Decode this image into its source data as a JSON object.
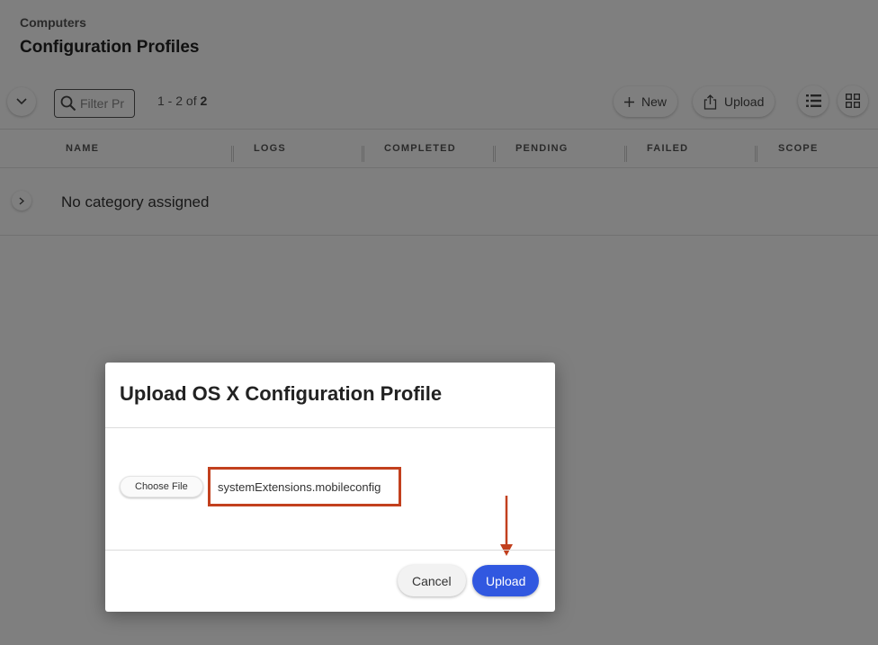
{
  "header": {
    "breadcrumb": "Computers",
    "title": "Configuration Profiles"
  },
  "toolbar": {
    "filter_placeholder": "Filter Pr",
    "count_prefix": "1 - 2 of ",
    "count_total": "2",
    "new_label": "New",
    "upload_label": "Upload"
  },
  "table": {
    "columns": [
      "NAME",
      "LOGS",
      "COMPLETED",
      "PENDING",
      "FAILED",
      "SCOPE"
    ],
    "category_label": "No category assigned"
  },
  "modal": {
    "title": "Upload OS X Configuration Profile",
    "choose_file_label": "Choose File",
    "file_name": "systemExtensions.mobileconfig",
    "cancel_label": "Cancel",
    "upload_label": "Upload"
  },
  "colors": {
    "primary": "#3158e0",
    "annotation": "#c2401e",
    "overlay": "rgba(0,0,0,0.5)"
  },
  "icons": [
    "chevron-down-icon",
    "search-icon",
    "plus-icon",
    "upload-icon",
    "list-view-icon",
    "grid-view-icon",
    "chevron-right-icon"
  ]
}
